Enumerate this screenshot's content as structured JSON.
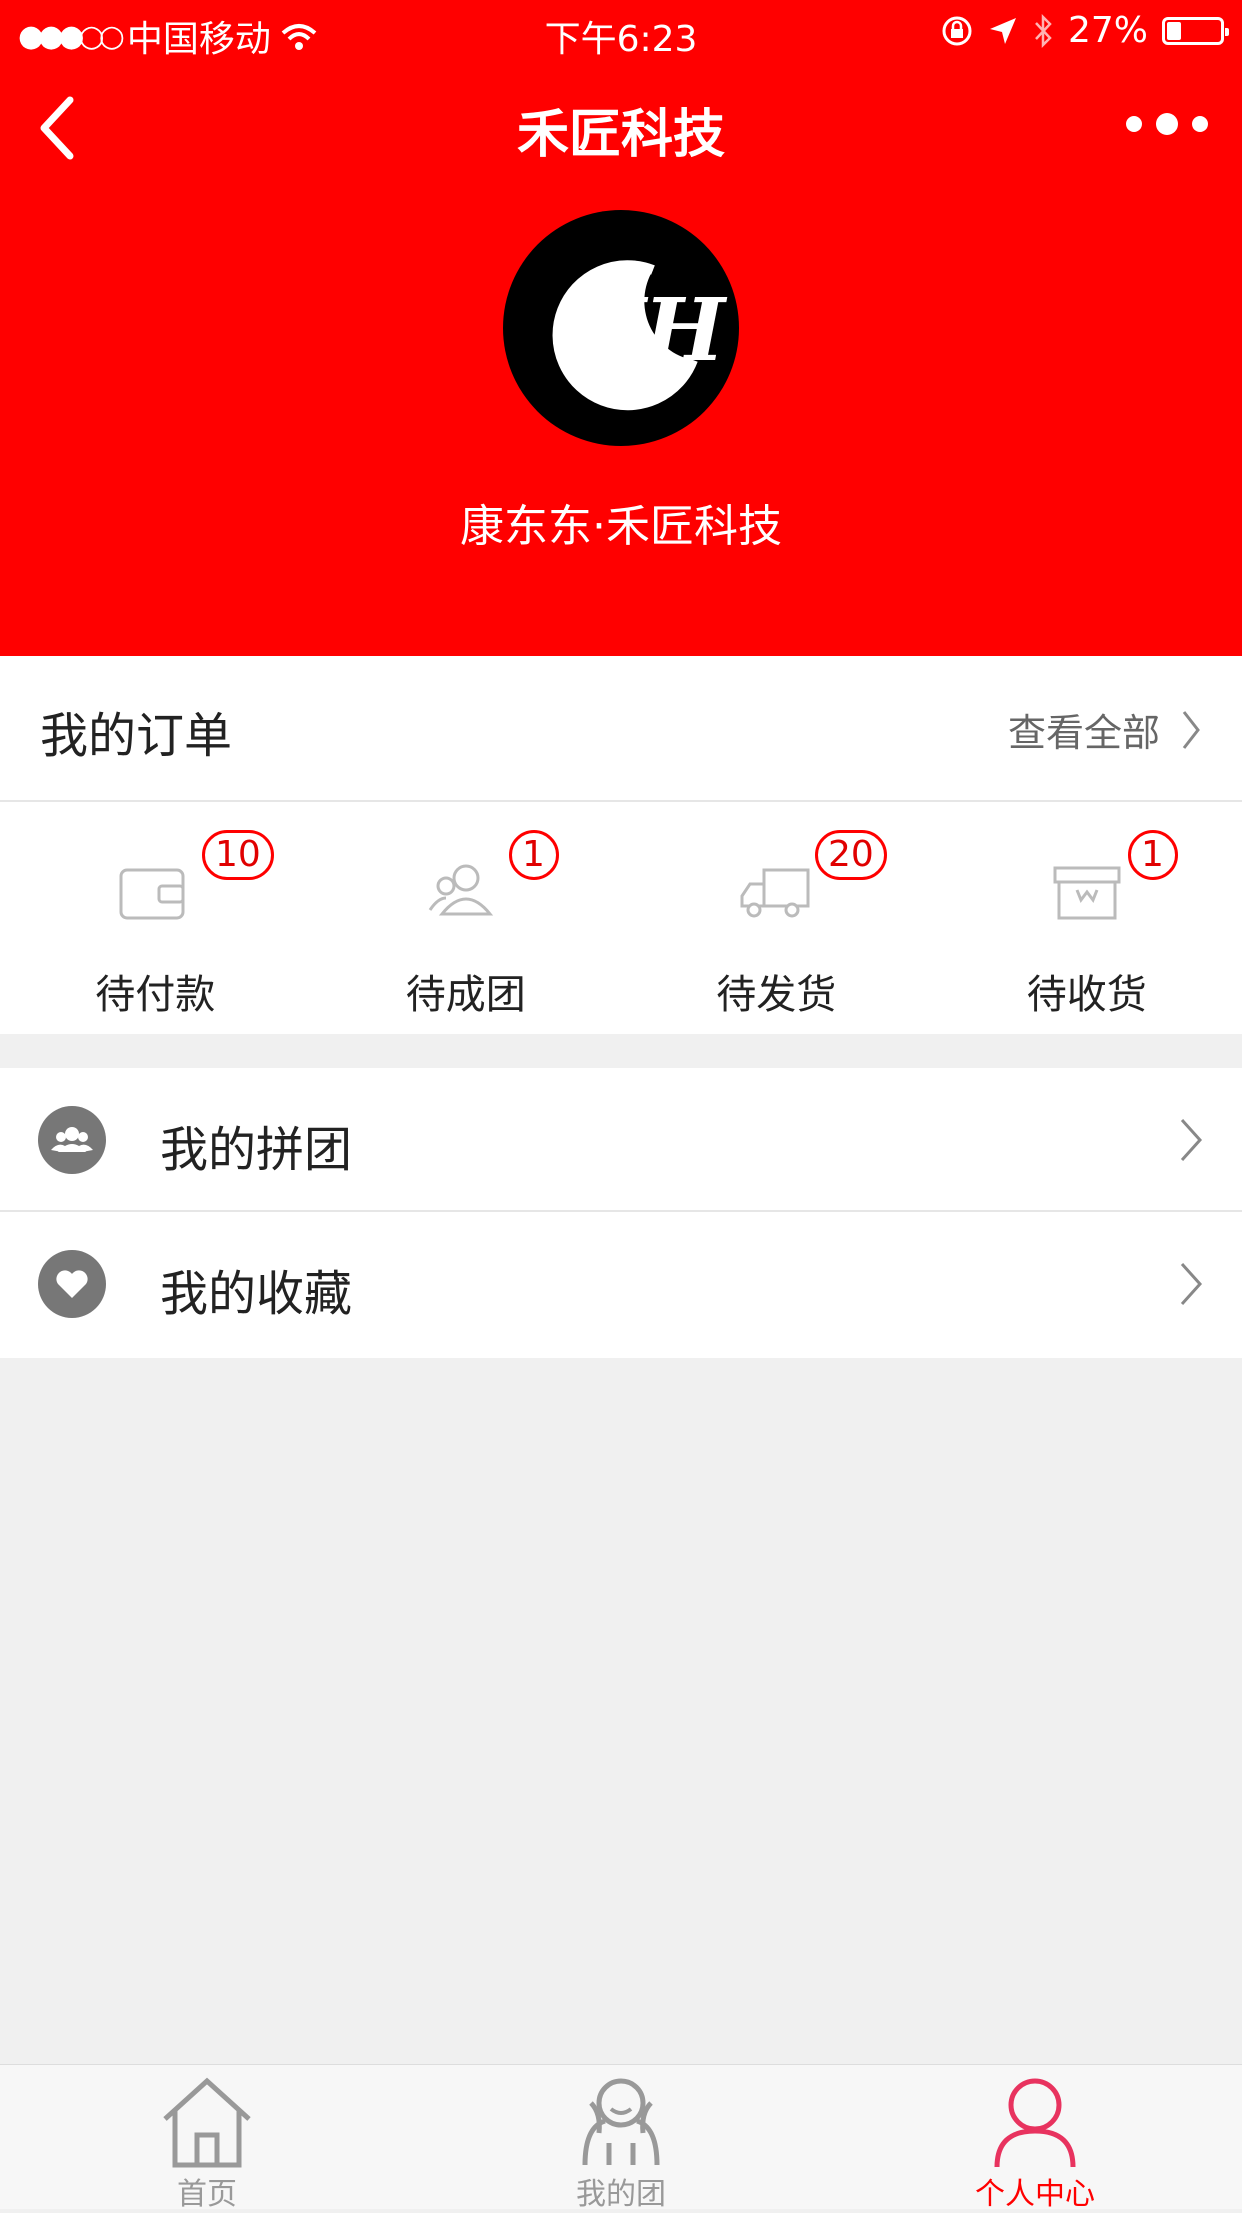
{
  "statusbar": {
    "carrier": "中国移动",
    "time": "下午6:23",
    "battery": "27%",
    "battery_level": 0.27
  },
  "navbar": {
    "title": "禾匠科技",
    "back_icon": "chevron-left-icon",
    "more_icon": "more-dots-icon"
  },
  "profile": {
    "avatar_logo": "JH",
    "username": "康东东·禾匠科技"
  },
  "orders": {
    "title": "我的订单",
    "view_all": "查看全部",
    "items": [
      {
        "label": "待付款",
        "badge": "10",
        "icon": "wallet-icon"
      },
      {
        "label": "待成团",
        "badge": "1",
        "icon": "group-icon"
      },
      {
        "label": "待发货",
        "badge": "20",
        "icon": "truck-icon"
      },
      {
        "label": "待收货",
        "badge": "1",
        "icon": "box-icon"
      }
    ]
  },
  "menu": {
    "items": [
      {
        "label": "我的拼团",
        "icon": "group-icon"
      },
      {
        "label": "我的收藏",
        "icon": "heart-icon"
      }
    ]
  },
  "tabbar": {
    "items": [
      {
        "label": "首页",
        "icon": "home-icon"
      },
      {
        "label": "我的团",
        "icon": "team-icon"
      },
      {
        "label": "个人中心",
        "icon": "person-icon",
        "active": true
      }
    ]
  },
  "colors": {
    "brand_red": "#ff0000",
    "badge_text": "#e00000",
    "background": "#f0f0f0"
  }
}
